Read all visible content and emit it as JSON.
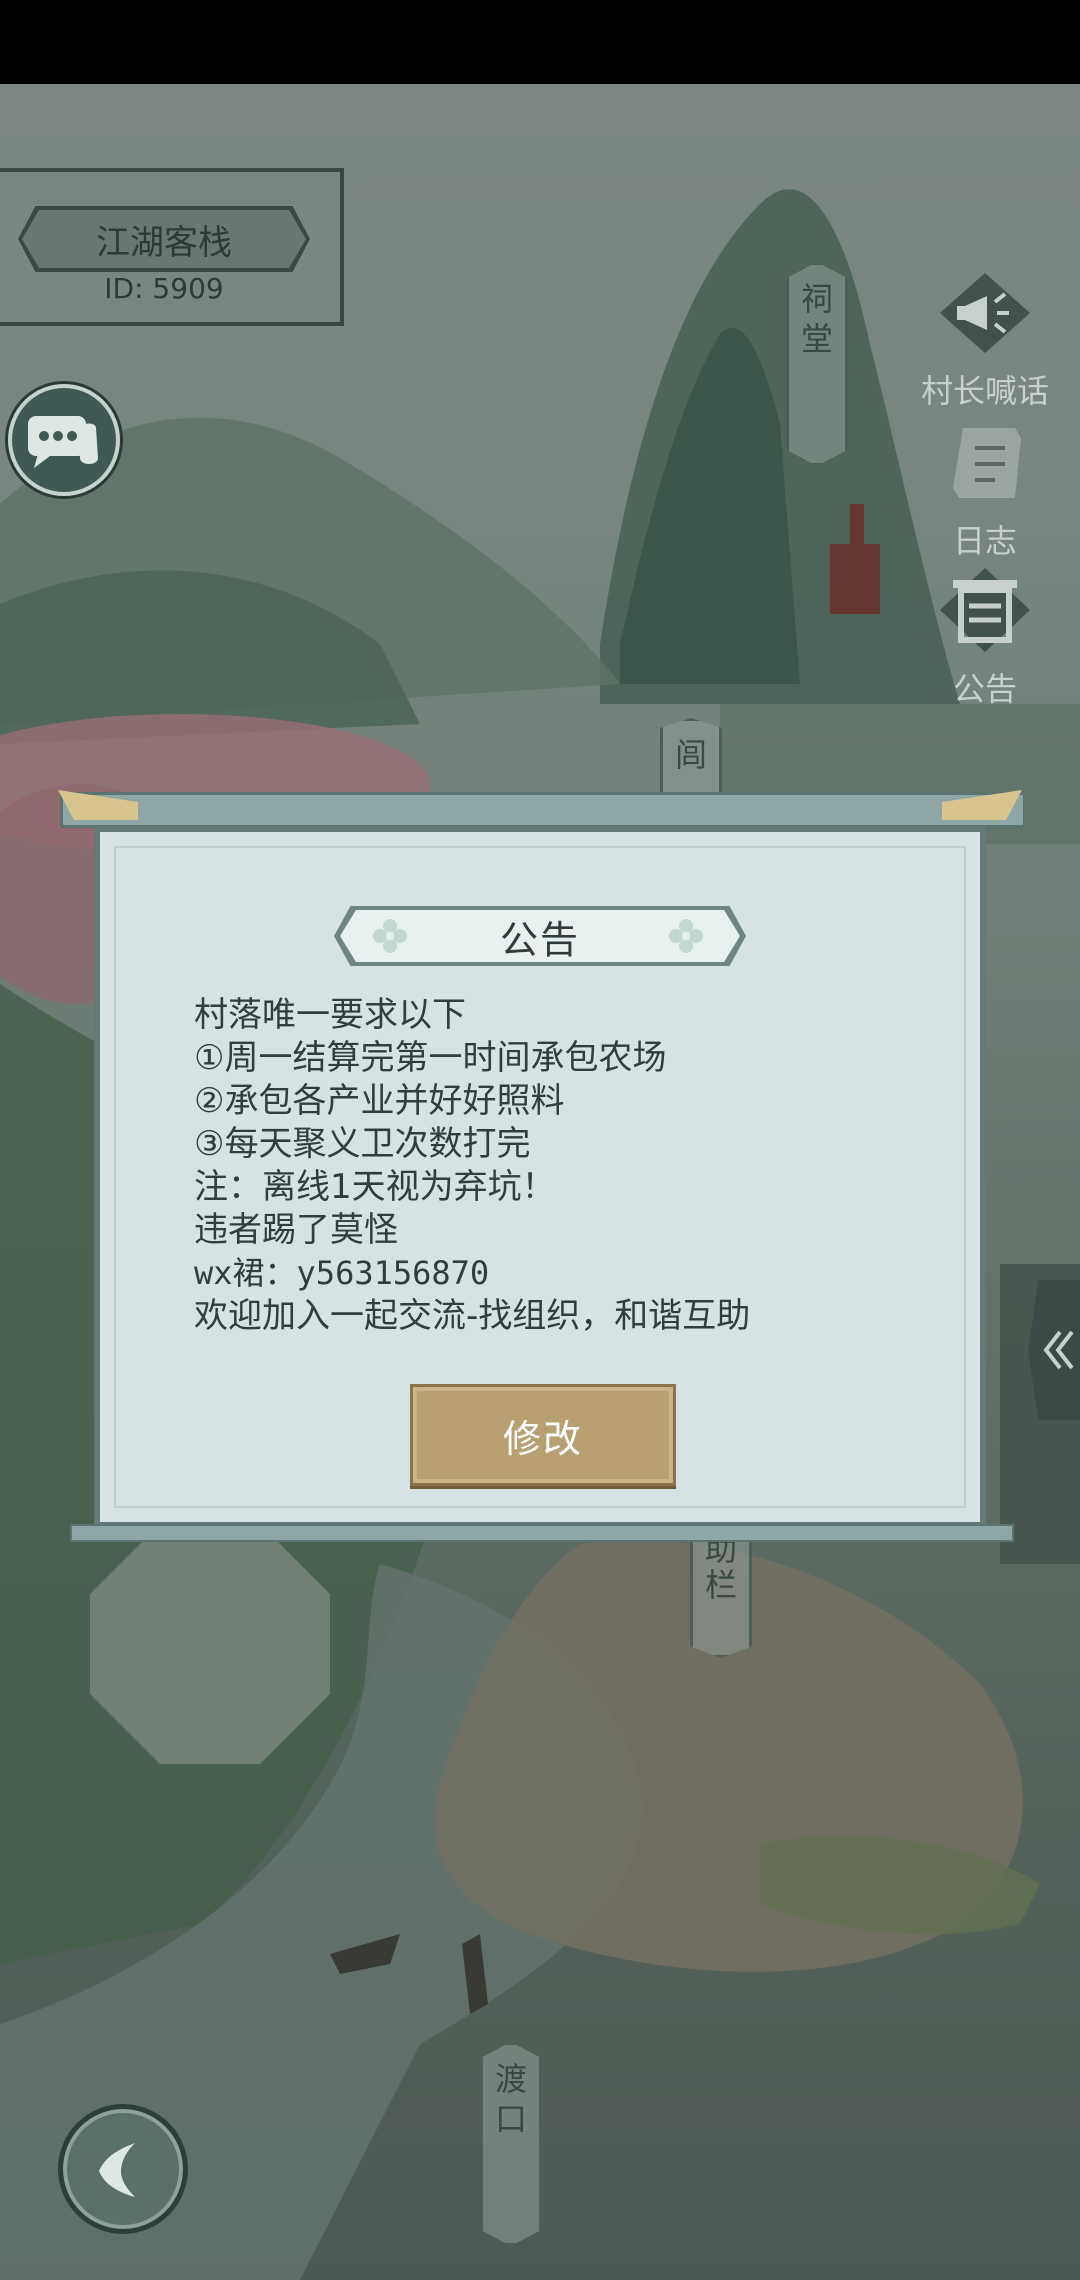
{
  "village": {
    "name": "江湖客栈",
    "id_text": "ID: 5909"
  },
  "right_menu": {
    "shout_label": "村长喊话",
    "log_label": "日志",
    "notice_label": "公告"
  },
  "map_labels": {
    "ancestral_hall": "祠堂",
    "partial_hall": "闾",
    "partial_bar": "助栏",
    "ferry": "渡口"
  },
  "dialog": {
    "title": "公告",
    "lines": [
      "村落唯一要求以下",
      "①周一结算完第一时间承包农场",
      "②承包各产业并好好照料",
      "③每天聚义卫次数打完",
      "注：离线1天视为弃坑！",
      "违者踢了莫怪",
      "wx裙：y563156870",
      "欢迎加入一起交流-找组织，和谐互助"
    ],
    "modify_button": "修改"
  },
  "icons": {
    "chat": "chat-bubble-icon",
    "shout": "megaphone-icon",
    "log": "scroll-icon",
    "notice": "gate-icon",
    "back": "back-arrow-icon",
    "side": "chevron-left-icon"
  }
}
